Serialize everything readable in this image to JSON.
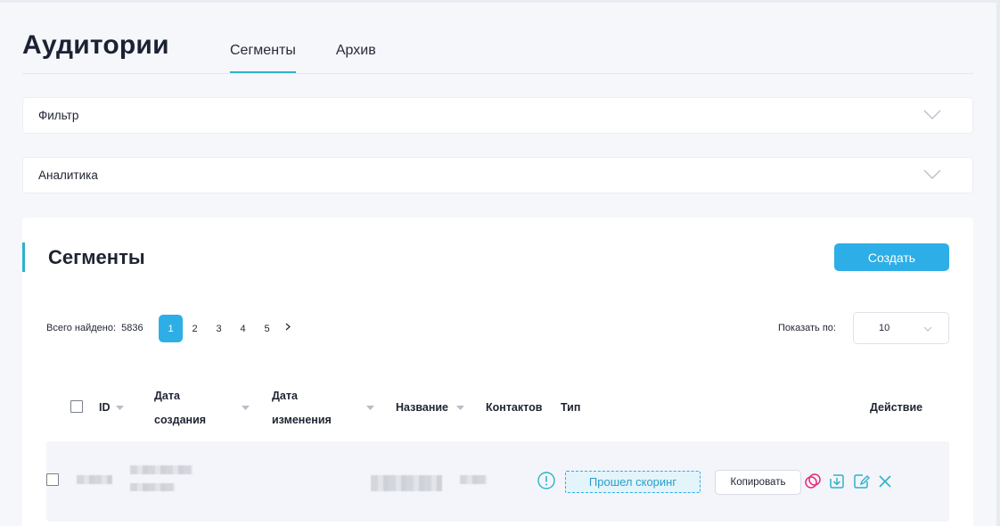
{
  "header": {
    "title": "Аудитории",
    "tabs": [
      {
        "label": "Сегменты",
        "active": true
      },
      {
        "label": "Архив",
        "active": false
      }
    ]
  },
  "accordions": {
    "filter": {
      "label": "Фильтр"
    },
    "analytics": {
      "label": "Аналитика"
    }
  },
  "segments": {
    "title": "Сегменты",
    "create_label": "Создать",
    "found_label": "Всего найдено:",
    "found_count": "5836",
    "pages": [
      "1",
      "2",
      "3",
      "4",
      "5"
    ],
    "current_page": "1",
    "show_label": "Показать по:",
    "page_size": "10",
    "table": {
      "columns": {
        "id": "ID",
        "created_line1": "Дата",
        "created_line2": "создания",
        "modified_line1": "Дата",
        "modified_line2": "изменения",
        "name": "Название",
        "contacts": "Контактов",
        "type": "Тип",
        "action": "Действие"
      },
      "rows": [
        {
          "status": "Прошел скоринг",
          "copy_label": "Копировать"
        }
      ]
    }
  },
  "colors": {
    "accent": "#2eb2c8",
    "primary_button": "#2eaee6",
    "delete": "#2eb2c8",
    "merge": "#e8287a"
  }
}
